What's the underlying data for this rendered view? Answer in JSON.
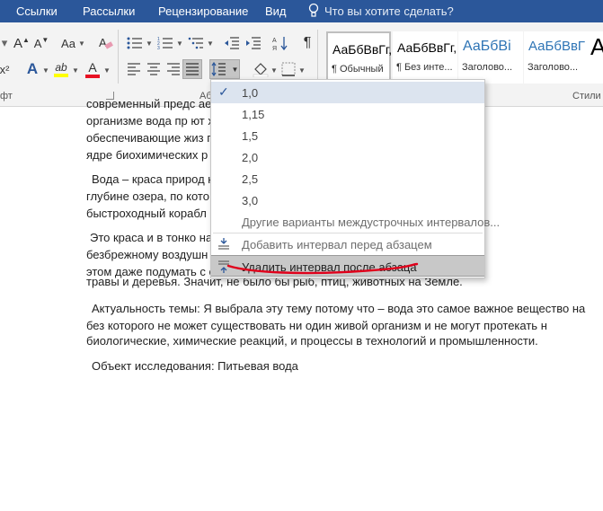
{
  "menubar": {
    "tabs": [
      "Ссылки",
      "Рассылки",
      "Рецензирование",
      "Вид"
    ],
    "tell_me": "Что вы хотите сделать?"
  },
  "ribbon": {
    "font_group_label_partial": "фт",
    "paragraph_group_label_partial": "Аб",
    "styles_group_label_partial": "Стили",
    "font_case_label": "Aa",
    "styles": [
      {
        "sample": "АаБбВвГг,",
        "name": "¶ Обычный"
      },
      {
        "sample": "АаБбВвГг,",
        "name": "¶ Без инте..."
      },
      {
        "sample": "АаБбВі",
        "name": "Заголово..."
      },
      {
        "sample": "АаБбВвГ",
        "name": "Заголово..."
      },
      {
        "sample": "А",
        "name": ""
      }
    ],
    "colors": {
      "highlight": "#ffff00",
      "font_color": "#e81123"
    }
  },
  "line_spacing_menu": {
    "options": [
      "1,0",
      "1,15",
      "1,5",
      "2,0",
      "2,5",
      "3,0"
    ],
    "selected": "1,0",
    "more_options": "Другие варианты междустрочных интервалов...",
    "add_space_before": "Добавить интервал перед абзацем",
    "remove_space_after": "Удалить интервал после абзаца"
  },
  "document": {
    "lines": [
      "современный предс                                               ается в морем. Во",
      "организме  вода  пр                                 ют  химические  пр",
      "обеспечивающие жиз                                  принимает участие в",
      "ядре биохимических р",
      "Вода – краса природ                                  ке, подернутой тумано",
      "глубине озера, по кото                                 инем море, где режет",
      "быстроходный корабл",
      "Это  краса  и  в  тонко                                  на  и  в  облаках  бегу",
      "безбрежному воздушн                                  ем влагой каждый ку",
      "этом даже подумать с                                  еки, моря, озера, сгор",
      "травы и деревья. Значит, не было бы рыб, птиц, животных на Земле.",
      "Актуальность темы: Я выбрала эту тему потому что – вода это самое важное вещество на",
      "без  которого  не  может  существовать  ни  один  живой  организм  и  не  могут  протекать  н",
      "биологические, химические реакций, и процессы в технологий и промышленности.",
      "Объект исследования: Питьевая вода"
    ]
  }
}
